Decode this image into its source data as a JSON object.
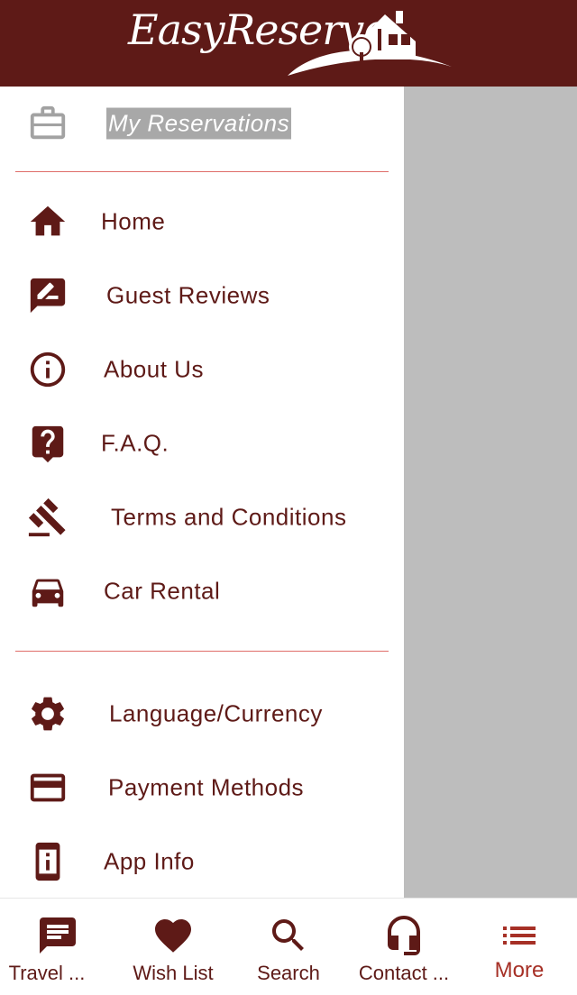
{
  "app": {
    "logo_text": "EasyReserve",
    "brand_color": "#5e1a17",
    "active_color": "#a63026",
    "divider_color": "#d9534f"
  },
  "drawer": {
    "reservations": {
      "label": "My Reservations",
      "icon": "briefcase-icon"
    },
    "items": [
      {
        "label": "Home",
        "icon": "home-icon"
      },
      {
        "label": "Guest Reviews",
        "icon": "rate-review-icon"
      },
      {
        "label": "About Us",
        "icon": "info-icon"
      },
      {
        "label": "F.A.Q.",
        "icon": "help-icon"
      },
      {
        "label": "Terms and Conditions",
        "icon": "gavel-icon"
      },
      {
        "label": "Car Rental",
        "icon": "car-icon"
      }
    ],
    "settings": [
      {
        "label": "Language/Currency",
        "icon": "gear-icon"
      },
      {
        "label": "Payment Methods",
        "icon": "credit-card-icon"
      },
      {
        "label": "App Info",
        "icon": "device-info-icon"
      }
    ]
  },
  "tabbar": {
    "tabs": [
      {
        "label": "Travel ...",
        "icon": "chat-icon"
      },
      {
        "label": "Wish List",
        "icon": "heart-icon"
      },
      {
        "label": "Search",
        "icon": "search-icon"
      },
      {
        "label": "Contact ...",
        "icon": "headset-icon"
      },
      {
        "label": "More",
        "icon": "list-icon",
        "active": true
      }
    ]
  }
}
